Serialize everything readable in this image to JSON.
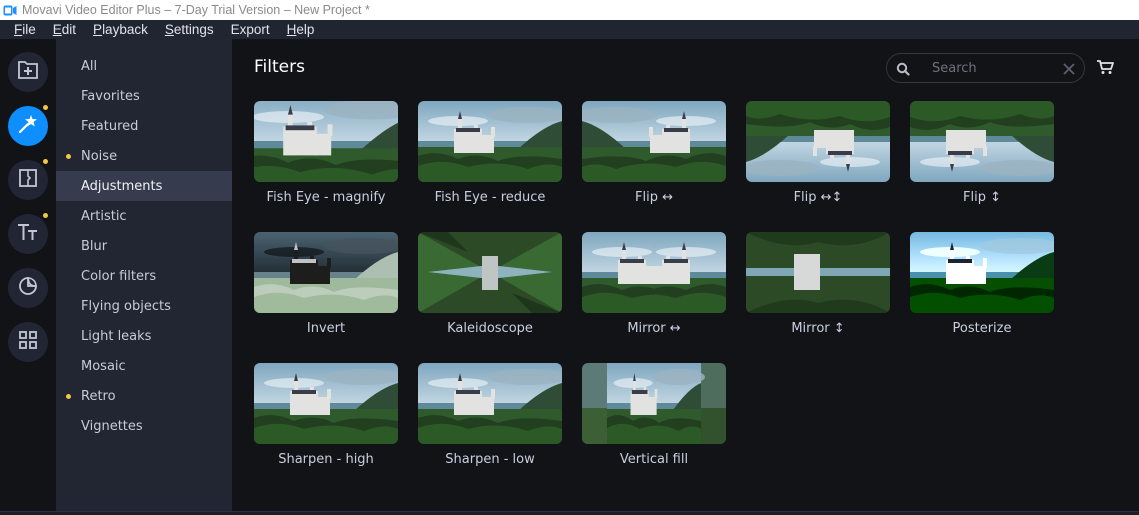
{
  "window": {
    "title": "Movavi Video Editor Plus – 7-Day Trial Version – New Project *",
    "app_icon": "movavi-camera-icon",
    "accent_color": "#0e8eff",
    "badge_color": "#f2c744"
  },
  "menubar": {
    "items": [
      {
        "label": "File",
        "mnemonic": "F"
      },
      {
        "label": "Edit",
        "mnemonic": "E"
      },
      {
        "label": "Playback",
        "mnemonic": "P"
      },
      {
        "label": "Settings",
        "mnemonic": "S"
      },
      {
        "label": "Export",
        "mnemonic": ""
      },
      {
        "label": "Help",
        "mnemonic": "H"
      }
    ]
  },
  "rail": {
    "buttons": [
      {
        "name": "import",
        "icon": "folder-plus-icon",
        "active": false,
        "badge": false
      },
      {
        "name": "filters",
        "icon": "magic-wand-icon",
        "active": true,
        "badge": true
      },
      {
        "name": "transitions",
        "icon": "transition-icon",
        "active": false,
        "badge": true
      },
      {
        "name": "titles",
        "icon": "text-tt-icon",
        "active": false,
        "badge": true
      },
      {
        "name": "stickers",
        "icon": "sticker-icon",
        "active": false,
        "badge": false
      },
      {
        "name": "more-tools",
        "icon": "grid-icon",
        "active": false,
        "badge": false
      }
    ]
  },
  "categories": {
    "selected": "Adjustments",
    "items": [
      {
        "label": "All",
        "new": false
      },
      {
        "label": "Favorites",
        "new": false
      },
      {
        "label": "Featured",
        "new": false
      },
      {
        "label": "Noise",
        "new": true
      },
      {
        "label": "Adjustments",
        "new": false
      },
      {
        "label": "Artistic",
        "new": false
      },
      {
        "label": "Blur",
        "new": false
      },
      {
        "label": "Color filters",
        "new": false
      },
      {
        "label": "Flying objects",
        "new": false
      },
      {
        "label": "Light leaks",
        "new": false
      },
      {
        "label": "Mosaic",
        "new": false
      },
      {
        "label": "Retro",
        "new": true
      },
      {
        "label": "Vignettes",
        "new": false
      }
    ]
  },
  "main": {
    "heading": "Filters",
    "search": {
      "placeholder": "Search",
      "value": ""
    },
    "filters": [
      {
        "label": "Fish Eye - magnify",
        "variant": "fisheye-magnify"
      },
      {
        "label": "Fish Eye - reduce",
        "variant": "fisheye-reduce"
      },
      {
        "label": "Flip ↔",
        "variant": "flip-h"
      },
      {
        "label": "Flip ↔↕",
        "variant": "flip-hv"
      },
      {
        "label": "Flip ↕",
        "variant": "flip-v"
      },
      {
        "label": "Invert",
        "variant": "invert"
      },
      {
        "label": "Kaleidoscope",
        "variant": "kaleidoscope"
      },
      {
        "label": "Mirror ↔",
        "variant": "mirror-h"
      },
      {
        "label": "Mirror ↕",
        "variant": "mirror-v"
      },
      {
        "label": "Posterize",
        "variant": "posterize"
      },
      {
        "label": "Sharpen - high",
        "variant": "normal"
      },
      {
        "label": "Sharpen - low",
        "variant": "normal"
      },
      {
        "label": "Vertical fill",
        "variant": "vertical-fill"
      }
    ]
  }
}
